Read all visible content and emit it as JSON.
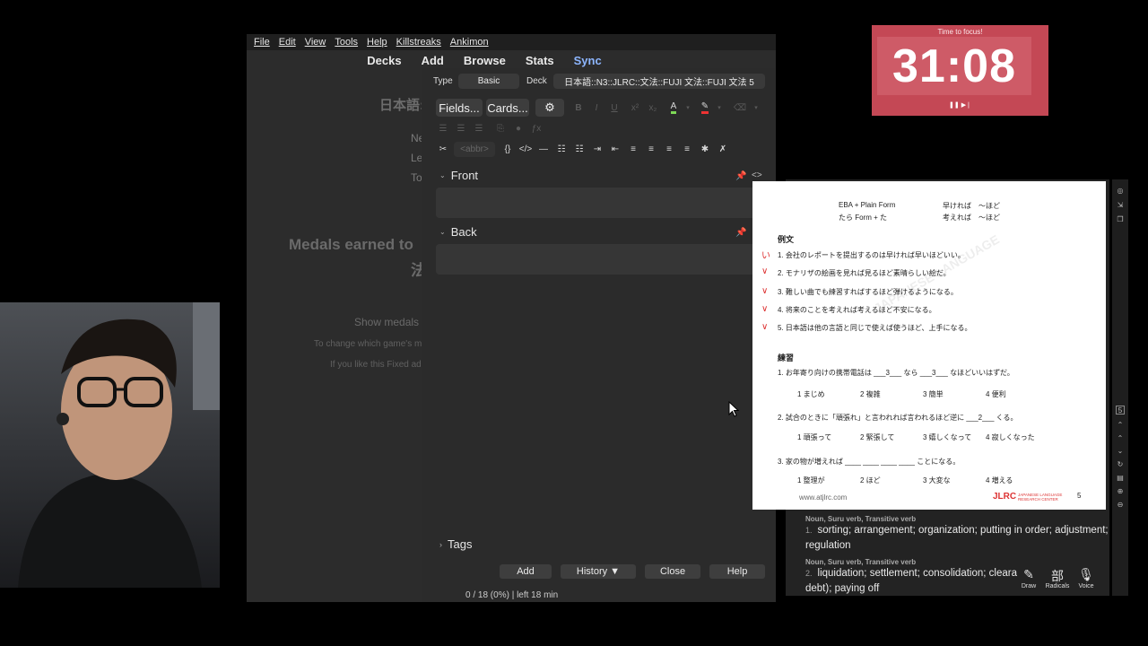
{
  "menubar": [
    "File",
    "Edit",
    "View",
    "Tools",
    "Help",
    "Killstreaks",
    "Ankimon"
  ],
  "toolbar": {
    "decks": "Decks",
    "add": "Add",
    "browse": "Browse",
    "stats": "Stats",
    "sync": "Sync"
  },
  "background": {
    "deckname": "日本語::",
    "new": "Ne",
    "learn": "Le",
    "review": "To",
    "medals1": "Medals earned to",
    "medals2": "法",
    "show_medals": "Show medals f",
    "change_game": "To change which game's me",
    "like_fixed": "If you like this Fixed add-"
  },
  "editor": {
    "type_label": "Type",
    "type_value": "Basic",
    "deck_label": "Deck",
    "deck_value": "日本語::N3::JLRC::文法::FUJI 文法::FUJI 文法 5",
    "fields_btn": "Fields...",
    "cards_btn": "Cards...",
    "abbr": "<abbr>",
    "front_label": "Front",
    "back_label": "Back",
    "tags_label": "Tags",
    "add_btn": "Add",
    "history_btn": "History ▼",
    "close_btn": "Close",
    "help_btn": "Help",
    "status": "0 / 18 (0%) | left 18 min"
  },
  "timer": {
    "label": "Time to focus!",
    "time": "31:08",
    "controls": "❚❚ ▶❘"
  },
  "pdf": {
    "pattern1_left": "EBA + Plain Form",
    "pattern1_right": "早ければ　～ほど",
    "pattern2_left": "たら Form + た",
    "pattern2_right": "考えれば　～ほど",
    "example_head": "例文",
    "examples": [
      "1. 会社のレポートを提出するのは早ければ早いほどいい。",
      "2. モナリザの絵画を見れば見るほど素晴らしい絵だ。",
      "3. 難しい曲でも練習すればするほど弾けるようになる。",
      "4. 将来のことを考えれば考えるほど不安になる。",
      "5. 日本語は他の言語と同じで使えば使うほど、上手になる。"
    ],
    "practice_head": "練習",
    "q1": "1. お年寄り向けの携帯電話は ___3___ なら ___3___ なほどいいはずだ。",
    "q1_opts": [
      "1 まじめ",
      "2 複雑",
      "3 簡単",
      "4 便利"
    ],
    "q2": "2. 試合のときに「頑張れ」と言われれば言われるほど逆に ___2___ くる。",
    "q2_opts": [
      "1 頑張って",
      "2 緊張して",
      "3 嬉しくなって",
      "4 寂しくなった"
    ],
    "q3": "3. 家の物が増えれば ____ ____ ____ ____ ことになる。",
    "q3_opts": [
      "1 整理が",
      "2 ほど",
      "3 大変な",
      "4 増える"
    ],
    "footer_url": "www.atjlrc.com",
    "footer_logo": "JLRC",
    "footer_logo_sub": "JAPANESE LANGUAGE RESEARCH CENTER",
    "page_num": "5"
  },
  "dictionary": {
    "pos1": "Noun, Suru verb, Transitive verb",
    "def1": "sorting; arrangement; organization; putting in order; adjustment; regulation",
    "pos2": "Noun, Suru verb, Transitive verb",
    "def2": "liquidation; settlement; consolidation; cleara",
    "def2b": "debt); paying off",
    "draw": "Draw",
    "radicals": "Radicals",
    "voice": "Voice"
  },
  "colors": {
    "timer_bg": "#c44855",
    "sync": "#8db6ff",
    "pdf_red": "#dd3333",
    "pdf_blue": "#3a4fc7"
  }
}
